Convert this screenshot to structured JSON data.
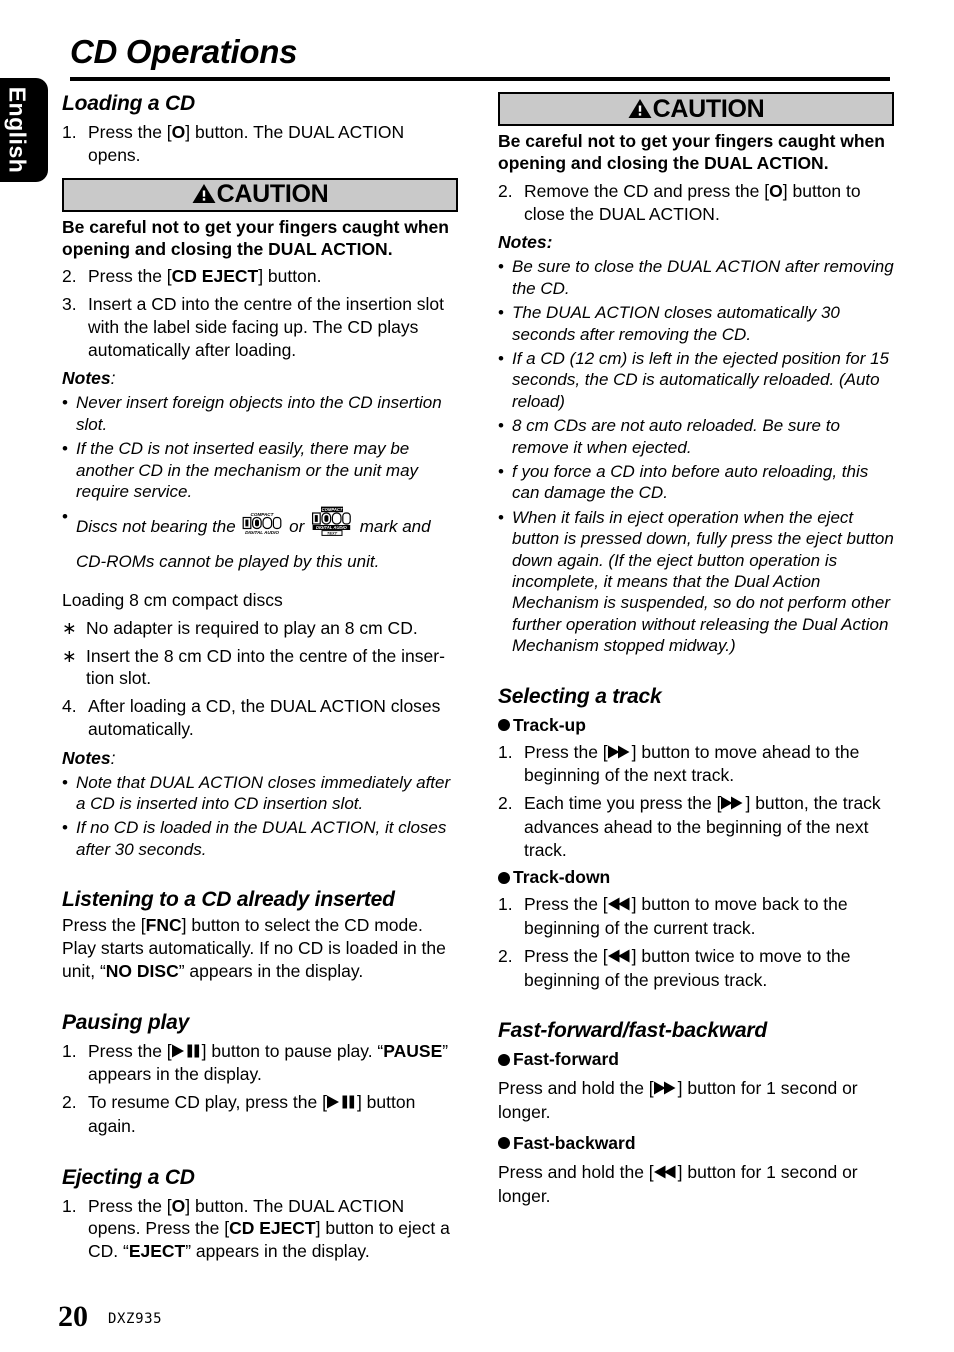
{
  "language_tab": "English",
  "page_title": "CD Operations",
  "footer": {
    "page_number": "20",
    "model": "DXZ935"
  },
  "caution": {
    "label": "CAUTION",
    "body": "Be careful not to get your fingers caught when opening and closing the DUAL ACTION."
  },
  "left_column": {
    "loading": {
      "heading": "Loading a CD",
      "step1_num": "1.",
      "step1_pre": "Press the [",
      "step1_key": "O",
      "step1_post": "] button. The DUAL ACTION opens.",
      "step2_num": "2.",
      "step2_pre": "Press the [",
      "step2_key": "CD EJECT",
      "step2_post": "] button.",
      "step3_num": "3.",
      "step3_text": "Insert a CD into the centre of the insertion slot with the label side facing up. The CD plays automatically after loading.",
      "notes_label": "Notes",
      "notes_colon": ":",
      "notes": [
        "Never insert foreign objects into the CD insertion slot.",
        "If the CD is not inserted easily, there may be another CD in the mechanism or the unit may require service."
      ],
      "disc_note_pre": "Discs not bearing the ",
      "disc_note_or": " or ",
      "disc_note_post": " mark and",
      "disc_note_line2": "CD-ROMs cannot  be played by this unit.",
      "logo1": {
        "top": "COMPACT",
        "word": "disc",
        "bottom": "DIGITAL AUDIO"
      },
      "logo2": {
        "top": "COMPACT",
        "word": "disc",
        "bottom": "DIGITAL AUDIO",
        "extra": "TEXT"
      }
    },
    "eight_cm": {
      "heading": "Loading 8 cm compact discs",
      "asterisk": "∗",
      "items": [
        "No adapter is required to play an 8 cm CD.",
        "Insert the 8 cm CD into the centre of the inser-tion slot."
      ],
      "item2_line1": "Insert the 8 cm CD into the centre of the inser-",
      "item2_line2": "tion slot.",
      "step4_num": "4.",
      "step4_text": "After loading a CD, the DUAL ACTION closes automatically.",
      "notes_label": "Notes",
      "notes_colon": ":",
      "notes": [
        "Note that DUAL ACTION closes immediately after a CD is inserted into CD insertion slot.",
        "If no CD is loaded in the DUAL ACTION, it closes after 30 seconds."
      ]
    },
    "listening": {
      "heading": "Listening to a CD already inserted",
      "pre": "Press the [",
      "key": "FNC",
      "mid": "] button to select the CD mode. Play starts automatically. If no CD is loaded in the unit, “",
      "key2": "NO DISC",
      "post": "” appears in the display."
    },
    "pausing": {
      "heading": "Pausing play",
      "step1_num": "1.",
      "step1_pre": "Press the [",
      "step1_post": "] button to pause play. “",
      "step1_key": "PAUSE",
      "step1_end": "” appears in the display.",
      "step2_num": "2.",
      "step2_pre": "To resume CD play, press the [",
      "step2_post": "] button again."
    },
    "ejecting": {
      "heading": "Ejecting a CD",
      "step1_num": "1.",
      "step1_a": "Press the [",
      "step1_key1": "O",
      "step1_b": "] button. The DUAL ACTION opens. Press the [",
      "step1_key2": "CD EJECT",
      "step1_c": "] button to eject a CD. “",
      "step1_key3": "EJECT",
      "step1_d": "” appears in the display."
    }
  },
  "right_column": {
    "step2_num": "2.",
    "step2_pre": "Remove the CD and press the [",
    "step2_key": "O",
    "step2_post": "] button to close the DUAL ACTION.",
    "notes_label": "Notes",
    "notes_colon": ":",
    "notes": [
      "Be sure to close the DUAL ACTION after removing the CD.",
      "The DUAL ACTION closes automatically 30 seconds after removing the CD.",
      "If a CD (12 cm) is left in the ejected position for 15 seconds, the CD is automatically reloaded. (Auto reload)",
      "8 cm CDs are not auto reloaded. Be sure to remove it when ejected.",
      "f you force a CD into before auto reloading, this can damage the CD.",
      "When it fails in eject operation when the eject button is pressed down, fully press the eject button down again.  (If the eject button operation is incomplete, it means that the Dual Action Mechanism is suspended, so do not perform other further operation without releasing the Dual Action Mechanism stopped midway.)"
    ],
    "selecting": {
      "heading": "Selecting a track",
      "trackup_label": "Track-up",
      "trackup_1_num": "1.",
      "trackup_1_pre": "Press the [",
      "trackup_1_post": "] button to move ahead to the beginning of the next track.",
      "trackup_2_num": "2.",
      "trackup_2_pre": "Each time you press the [",
      "trackup_2_post": "] button, the track advances ahead to the beginning of the next track.",
      "trackdown_label": "Track-down",
      "trackdown_1_num": "1.",
      "trackdown_1_pre": "Press the [",
      "trackdown_1_post": "] button to move back to the beginning of the current track.",
      "trackdown_2_num": "2.",
      "trackdown_2_pre": "Press the [",
      "trackdown_2_post": "] button twice to move to the beginning of the previous track."
    },
    "fast": {
      "heading": "Fast-forward/fast-backward",
      "ff_label": "Fast-forward",
      "ff_pre": "Press and hold the [",
      "ff_post": "] button for 1 second or longer.",
      "fb_label": "Fast-backward",
      "fb_pre": "Press and hold the [",
      "fb_post": "] button for 1 second or longer."
    }
  },
  "icons": {
    "warning": "warning-triangle-icon",
    "play_pause": "play-pause-icon",
    "track_up": "fast-forward-icon",
    "track_down": "rewind-icon"
  },
  "colors": {
    "caution_bg": "#c9c9c9",
    "rule": "#000000",
    "tab_bg": "#000000"
  }
}
